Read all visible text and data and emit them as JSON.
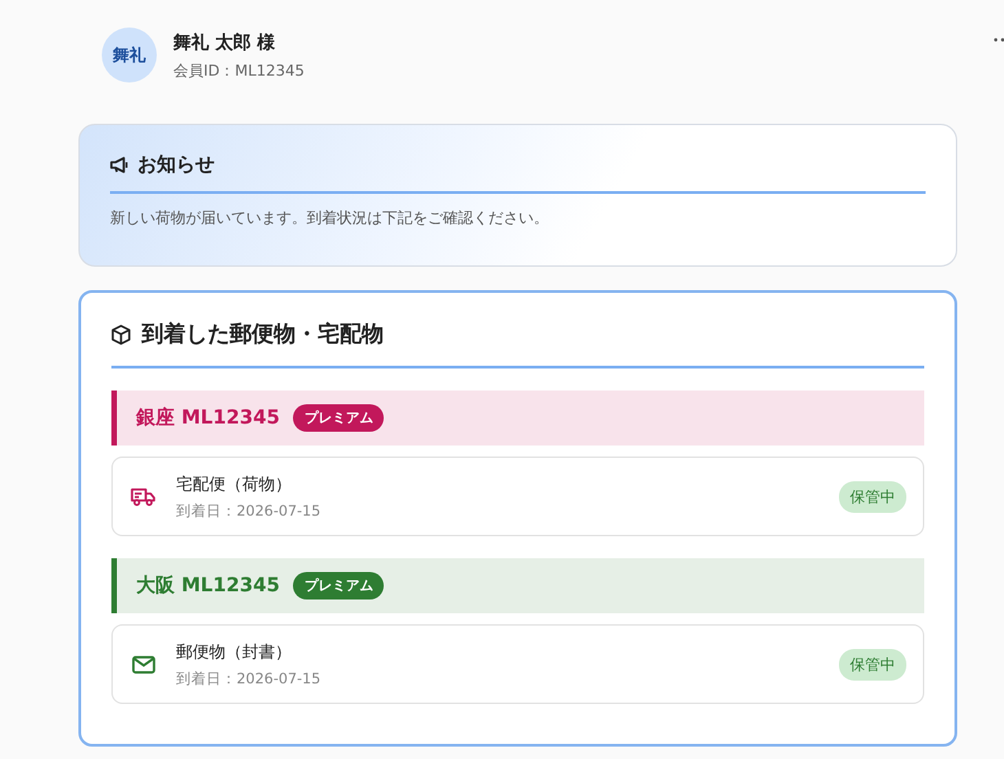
{
  "user": {
    "avatar": "舞礼",
    "name": "舞礼 太郎 様",
    "member_id": "会員ID：ML12345"
  },
  "notice": {
    "title": "お知らせ",
    "message": "新しい荷物が届いています。到着状況は下記をご確認ください。"
  },
  "arrivals": {
    "title": "到着した郵便物・宅配物",
    "locations": [
      {
        "name": "銀座 ML12345",
        "badge": "プレミアム",
        "color": "#c2185b",
        "items": [
          {
            "kind": "parcel",
            "title": "宅配便（荷物）",
            "date": "到着日：2026-07-15",
            "status": "保管中"
          }
        ]
      },
      {
        "name": "大阪 ML12345",
        "badge": "プレミアム",
        "color": "#2e7d32",
        "items": [
          {
            "kind": "letter",
            "title": "郵便物（封書）",
            "date": "到着日：2026-07-15",
            "status": "保管中"
          }
        ]
      }
    ]
  }
}
